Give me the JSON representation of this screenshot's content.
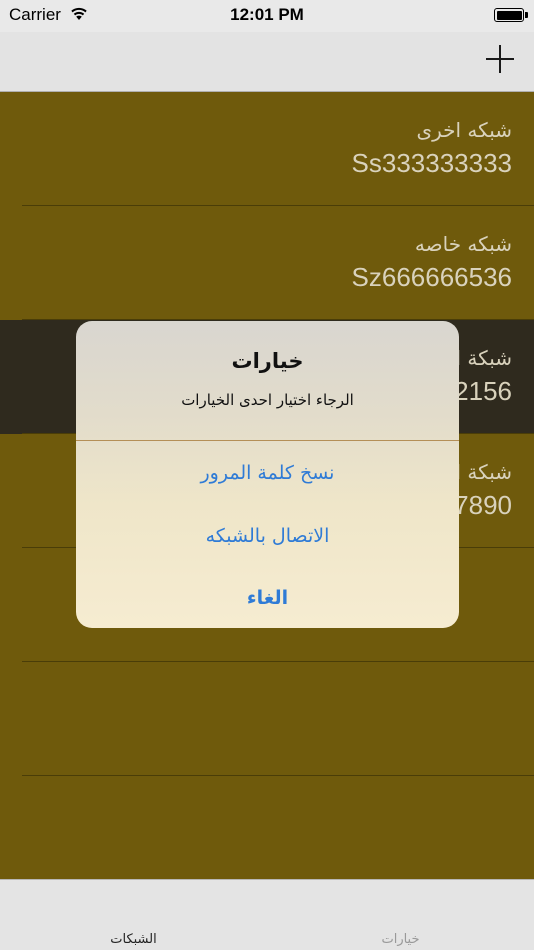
{
  "status_bar": {
    "carrier": "Carrier",
    "time": "12:01 PM"
  },
  "networks": [
    {
      "name": "شبكه اخرى",
      "ssid": "Ss333333333"
    },
    {
      "name": "شبكه خاصه",
      "ssid": "Sz666666536"
    },
    {
      "name": "شبكة ا",
      "ssid": "2156"
    },
    {
      "name": "شبكة ا",
      "ssid": "7890"
    }
  ],
  "alert": {
    "title": "خيارات",
    "message": "الرجاء اختيار احدى الخيارات",
    "actions": {
      "copy_password": "نسخ كلمة المرور",
      "connect": "الاتصال بالشبكه",
      "cancel": "الغاء"
    }
  },
  "tab_bar": {
    "networks_label": "الشبكات",
    "options_label": "خيارات"
  },
  "colors": {
    "list_background": "#6f5a0c",
    "selected_row": "#2f2a1e",
    "alert_action": "#2f7bd6"
  }
}
